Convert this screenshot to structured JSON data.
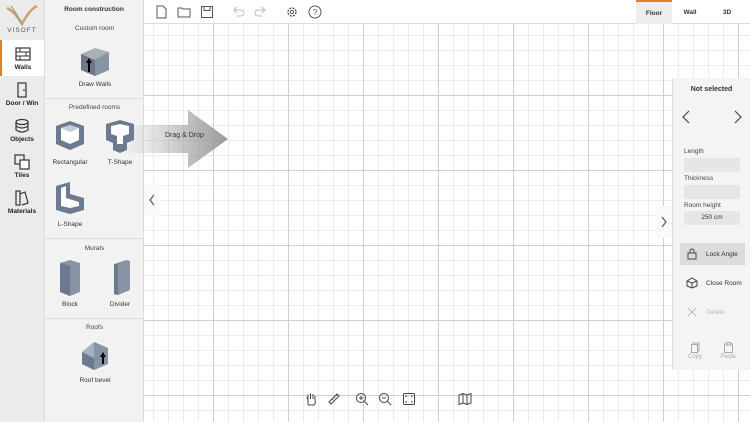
{
  "logo": {
    "text": "VISOFT"
  },
  "rail": {
    "items": [
      {
        "label": "Walls",
        "icon": "walls-icon"
      },
      {
        "label": "Door / Win",
        "icon": "door-icon"
      },
      {
        "label": "Objects",
        "icon": "objects-icon"
      },
      {
        "label": "Tiles",
        "icon": "tiles-icon"
      },
      {
        "label": "Materials",
        "icon": "materials-icon"
      }
    ],
    "active": "Walls"
  },
  "catalog": {
    "title": "Room construction",
    "sections": {
      "custom": "Custom room",
      "predefined": "Predefined rooms",
      "murals": "Murals",
      "roofs": "Roofs"
    },
    "items": {
      "draw_walls": "Draw Walls",
      "rectangular": "Rectangular",
      "t_shape": "T-Shape",
      "l_shape": "L-Shape",
      "block": "Block",
      "divider": "Divider",
      "roof_bevel": "Roof bevel"
    }
  },
  "toolbar": {
    "views": [
      "Floor",
      "Wall",
      "3D"
    ],
    "active_view": "Floor"
  },
  "canvas": {
    "drag_hint": "Drag & Drop"
  },
  "properties": {
    "title": "Not selected",
    "length_label": "Length",
    "length_value": "",
    "thickness_label": "Thickness",
    "thickness_value": "",
    "room_height_label": "Room height",
    "room_height_value": "250 cm",
    "lock_angle": "Lock Angle",
    "close_room": "Close Room",
    "delete": "Delete",
    "copy": "Copy",
    "paste": "Paste"
  },
  "colors": {
    "accent": "#e67e22",
    "wall": "#6b7a8f"
  }
}
